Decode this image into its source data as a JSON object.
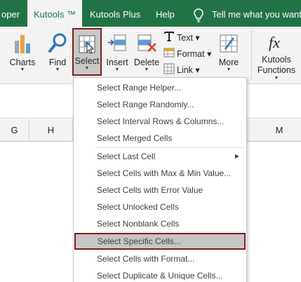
{
  "tabs": {
    "developer": "oper",
    "kutools": "Kutools ™",
    "kutools_plus": "Kutools Plus",
    "help": "Help",
    "tell_me": "Tell me what you want t"
  },
  "ribbon": {
    "charts": "Charts",
    "find": "Find",
    "select": "Select",
    "insert": "Insert",
    "delete": "Delete",
    "text": "Text",
    "format": "Format",
    "link": "Link",
    "more": "More",
    "kutools_functions_line1": "Kutools",
    "kutools_functions_line2": "Functions"
  },
  "columns": [
    "G",
    "H",
    "M"
  ],
  "menu": {
    "items": [
      {
        "label": "Select Range Helper..."
      },
      {
        "label": "Select Range Randomly..."
      },
      {
        "label": "Select Interval Rows & Columns..."
      },
      {
        "label": "Select Merged Cells"
      },
      {
        "label": "Select Last Cell"
      },
      {
        "label": "Select Cells with Max & Min Value..."
      },
      {
        "label": "Select Cells with Error Value"
      },
      {
        "label": "Select Unlocked Cells"
      },
      {
        "label": "Select Nonblank Cells"
      },
      {
        "label": "Select Specific Cells..."
      },
      {
        "label": "Select Cells with Format..."
      },
      {
        "label": "Select Duplicate & Unique Cells..."
      }
    ],
    "highlighted_item": "Select Specific Cells..."
  },
  "colors": {
    "excel_green": "#217346",
    "highlight_border": "#7b1d1d",
    "ribbon_bg": "#f3f3f3"
  },
  "icons": [
    "charts-icon",
    "find-icon",
    "select-icon",
    "insert-icon",
    "delete-icon",
    "text-icon",
    "format-icon",
    "link-icon",
    "more-icon",
    "fx-icon",
    "lightbulb-icon",
    "submenu-arrow-icon"
  ]
}
